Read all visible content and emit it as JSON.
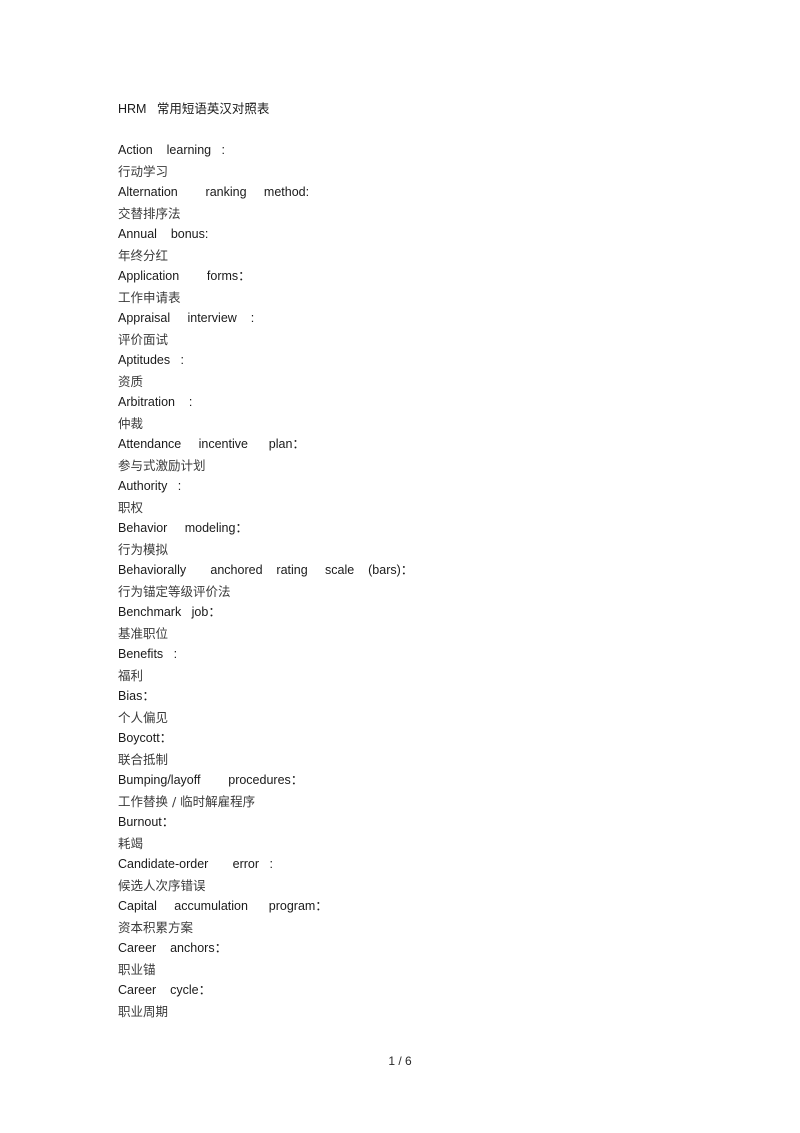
{
  "document": {
    "title": "HRM   常用短语英汉对照表",
    "entries": [
      {
        "term": "Action    learning   :",
        "gloss": "行动学习"
      },
      {
        "term": "Alternation        ranking     method:",
        "gloss": "交替排序法"
      },
      {
        "term": "Annual    bonus:",
        "gloss": "年终分红"
      },
      {
        "term": "Application        forms：",
        "gloss": "工作申请表"
      },
      {
        "term": "Appraisal     interview    :",
        "gloss": "评价面试"
      },
      {
        "term": "Aptitudes   :",
        "gloss": "资质"
      },
      {
        "term": "Arbitration    :",
        "gloss": "仲裁"
      },
      {
        "term": "Attendance     incentive      plan：",
        "gloss": "参与式激励计划"
      },
      {
        "term": "Authority   :",
        "gloss": "职权"
      },
      {
        "term": "Behavior     modeling：",
        "gloss": "行为模拟"
      },
      {
        "term": "Behaviorally       anchored    rating     scale    (bars)：",
        "gloss": "行为锚定等级评价法"
      },
      {
        "term": "Benchmark   job：",
        "gloss": "基准职位"
      },
      {
        "term": "Benefits   :",
        "gloss": "福利"
      },
      {
        "term": "Bias：",
        "gloss": "个人偏见"
      },
      {
        "term": "Boycott：",
        "gloss": "联合抵制"
      },
      {
        "term": "Bumping/layoff        procedures：",
        "gloss": "工作替换 / 临时解雇程序"
      },
      {
        "term": "Burnout：",
        "gloss": "耗竭"
      },
      {
        "term": "Candidate-order       error   :",
        "gloss": "候选人次序错误"
      },
      {
        "term": "Capital     accumulation      program：",
        "gloss": "资本积累方案"
      },
      {
        "term": "Career    anchors：",
        "gloss": "职业锚"
      },
      {
        "term": "Career    cycle：",
        "gloss": "职业周期"
      }
    ]
  },
  "footer": {
    "page_indicator": "1 / 6"
  }
}
